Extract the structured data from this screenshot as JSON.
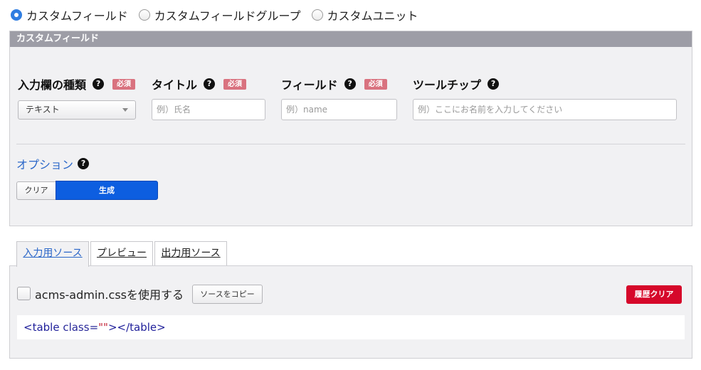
{
  "type_selector": [
    {
      "label": "カスタムフィールド",
      "checked": true
    },
    {
      "label": "カスタムフィールドグループ",
      "checked": false
    },
    {
      "label": "カスタムユニット",
      "checked": false
    }
  ],
  "panel": {
    "header": "カスタムフィールド",
    "fields": {
      "input_type": {
        "label": "入力欄の種類",
        "required": "必須",
        "selected": "テキスト"
      },
      "title": {
        "label": "タイトル",
        "required": "必須",
        "placeholder": "例）氏名"
      },
      "field": {
        "label": "フィールド",
        "required": "必須",
        "placeholder": "例）name"
      },
      "tooltip": {
        "label": "ツールチップ",
        "placeholder": "例）ここにお名前を入力してください"
      }
    },
    "help_glyph": "?",
    "options_label": "オプション",
    "clear_label": "クリア",
    "generate_label": "生成"
  },
  "tabs": [
    {
      "label": "入力用ソース",
      "active": true
    },
    {
      "label": "プレビュー",
      "active": false
    },
    {
      "label": "出力用ソース",
      "active": false
    }
  ],
  "source": {
    "checkbox_label": "acms-admin.cssを使用する",
    "copy_label": "ソースをコピー",
    "history_clear_label": "履歴クリア",
    "code": {
      "open": "<table ",
      "attr": "class=",
      "value": "\"\"",
      "close": "></table>"
    }
  },
  "colors": {
    "accent_blue": "#2f7de1",
    "primary_button": "#0d5ee0",
    "danger_button": "#d6082a",
    "required_badge": "#d9727f",
    "panel_header": "#9d9da6"
  }
}
